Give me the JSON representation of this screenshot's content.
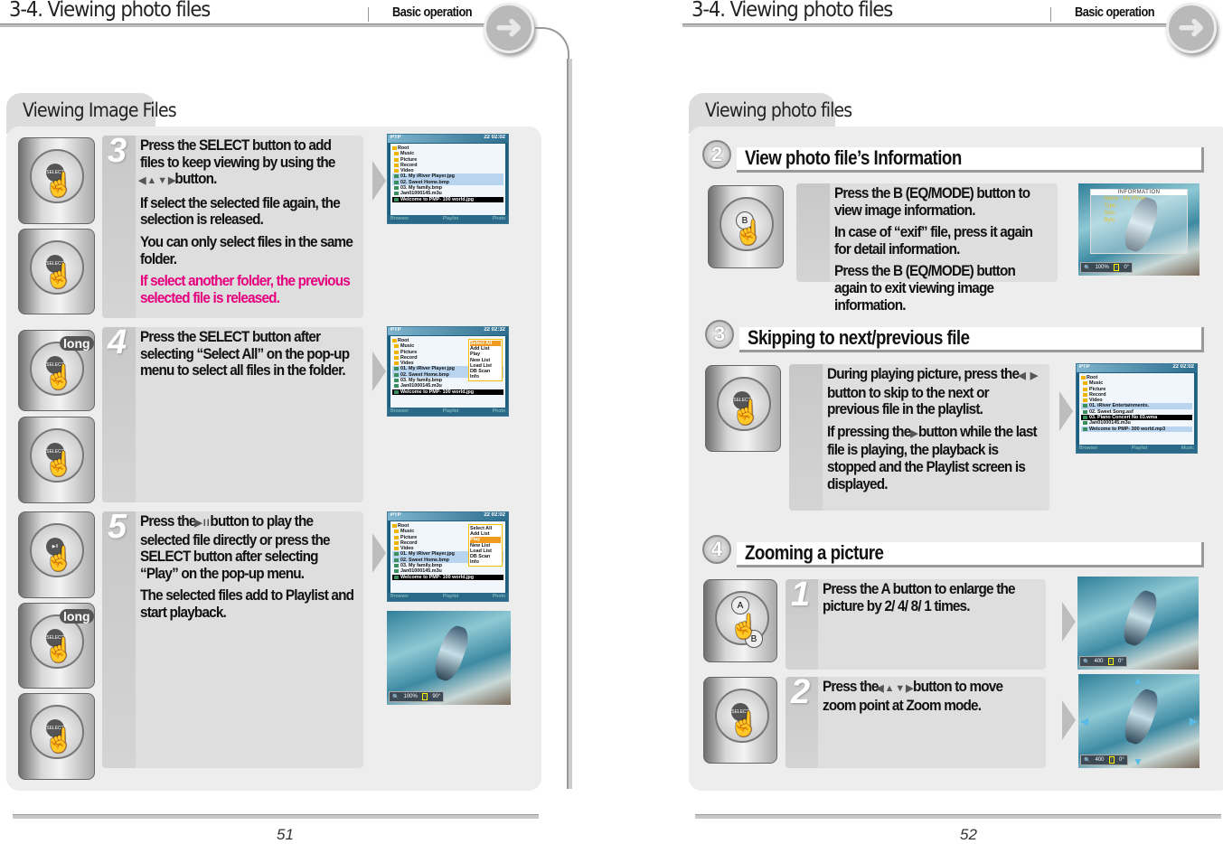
{
  "left": {
    "header": {
      "title": "3-4. Viewing photo files",
      "badge": "Basic operation"
    },
    "section_tab": "Viewing Image Files",
    "steps": [
      {
        "number": "3",
        "paragraphs": [
          {
            "before": "Press the SELECT button to add files to keep viewing by using the",
            "icon": "direction-arrows",
            "after": "button."
          },
          {
            "text": "If select the selected file again, the selection is released."
          },
          {
            "text": "You can only select files in the same folder."
          },
          {
            "text": "If select another folder, the previous selected file is released.",
            "highlight": true
          }
        ]
      },
      {
        "number": "4",
        "paragraphs": [
          {
            "text": "Press the SELECT button after selecting “Select All” on the pop-up menu to select all files in the folder."
          }
        ]
      },
      {
        "number": "5",
        "paragraphs": [
          {
            "before": "Press the",
            "icon": "play-pause",
            "after": "button to play the selected file directly or press the SELECT button after selecting “Play” on the pop-up menu."
          },
          {
            "text": "The selected files add to Playlist and start playback."
          }
        ]
      }
    ],
    "devices": [
      {
        "label": "SELECT"
      },
      {
        "label": "SELECT"
      },
      {
        "label": "SELECT",
        "badge": "long"
      },
      {
        "label": "SELECT"
      },
      {
        "label": "▶II"
      },
      {
        "label": "SELECT",
        "badge": "long"
      },
      {
        "label": "SELECT"
      }
    ],
    "page_number": "51"
  },
  "right": {
    "header": {
      "title": "3-4. Viewing photo files",
      "badge": "Basic operation"
    },
    "section_tab": "Viewing photo files",
    "subsections": [
      {
        "number": "2",
        "title": "View photo file’s Information",
        "paragraphs": [
          {
            "text": "Press the B (EQ/MODE) button to view image information."
          },
          {
            "text": "In case of “exif” file, press it again for detail information."
          },
          {
            "text": "Press the B (EQ/MODE) button again to exit viewing image information."
          }
        ]
      },
      {
        "number": "3",
        "title": "Skipping to next/previous file",
        "paragraphs": [
          {
            "before": "During playing picture, press the",
            "icon": "left-right-arrows",
            "after": "button to skip to the next or previous file in the playlist."
          },
          {
            "before": "If pressing the",
            "icon": "right-arrow",
            "after": "button while the last file is playing, the playback is stopped and the Playlist screen is displayed."
          }
        ]
      },
      {
        "number": "4",
        "title": "Zooming a picture",
        "steps": [
          {
            "number": "1",
            "paragraphs": [
              {
                "text": "Press the A button to enlarge the picture by 2/ 4/ 8/ 1 times."
              }
            ]
          },
          {
            "number": "2",
            "paragraphs": [
              {
                "before": "Press the",
                "icon": "direction-arrows",
                "after": "button to move zoom point at Zoom mode."
              }
            ]
          }
        ]
      }
    ],
    "devices": [
      {
        "label": "B"
      },
      {
        "label": "SELECT"
      },
      {
        "label": "A",
        "label2": "B"
      },
      {
        "label": "SELECT"
      }
    ],
    "page_number": "52"
  },
  "screens": {
    "s3": {
      "brand": "PTP",
      "status": "22  02:02",
      "items": [
        {
          "t": "Root",
          "k": "root"
        },
        {
          "t": "Music"
        },
        {
          "t": "Picture"
        },
        {
          "t": "Record"
        },
        {
          "t": "Video"
        },
        {
          "t": "01. My iRiver Player.jpg",
          "k": "file sel"
        },
        {
          "t": "02. Sweet Home.bmp",
          "k": "file sel"
        },
        {
          "t": "03. My family.bmp",
          "k": "file"
        },
        {
          "t": "Jan01000145.m3u",
          "k": "file"
        },
        {
          "t": "Welcome to PMP- 100 world.jpg",
          "k": "file cur"
        }
      ],
      "footer": [
        "Browser",
        "Playlist",
        "Photo"
      ]
    },
    "s4": {
      "brand": "PTP",
      "status": "22  02:32",
      "items": [
        {
          "t": "Root",
          "k": "root"
        },
        {
          "t": "Music"
        },
        {
          "t": "Picture"
        },
        {
          "t": "Record"
        },
        {
          "t": "Video"
        },
        {
          "t": "01. My iRiver Player.jpg",
          "k": "file sel"
        },
        {
          "t": "02. Sweet Home.bmp",
          "k": "file sel"
        },
        {
          "t": "03. My family.bmp",
          "k": "file"
        },
        {
          "t": "Jan01000145.m3u",
          "k": "file"
        },
        {
          "t": "Welcome to PMP- 100 world.jpg",
          "k": "file cur"
        }
      ],
      "popup": [
        "Select All",
        "Add List",
        "Play",
        "New List",
        "Load List",
        "DB Scan",
        "Info"
      ],
      "popup_active": 0,
      "footer": [
        "Browser",
        "Playlist",
        "Photo"
      ]
    },
    "s5": {
      "brand": "PTP",
      "status": "22  02:02",
      "items": [
        {
          "t": "Root",
          "k": "root"
        },
        {
          "t": "Music"
        },
        {
          "t": "Picture"
        },
        {
          "t": "Record"
        },
        {
          "t": "Video"
        },
        {
          "t": "01. My iRiver Player.jpg",
          "k": "file sel"
        },
        {
          "t": "02. Sweet Home.bmp",
          "k": "file sel"
        },
        {
          "t": "03. My family.bmp",
          "k": "file"
        },
        {
          "t": "Jan01000145.m3u",
          "k": "file"
        },
        {
          "t": "Welcome to PMP- 100 world.jpg",
          "k": "file cur"
        }
      ],
      "popup": [
        "Select All",
        "Add List",
        "Play",
        "New List",
        "Load List",
        "DB Scan",
        "Info"
      ],
      "popup_active": 2,
      "footer": [
        "Browser",
        "Playlist",
        "Photo"
      ]
    },
    "skip": {
      "brand": "PTP",
      "status": "22  02:02",
      "items": [
        {
          "t": "Root",
          "k": "root"
        },
        {
          "t": "Music"
        },
        {
          "t": "Picture"
        },
        {
          "t": "Record"
        },
        {
          "t": "Video"
        },
        {
          "t": "01. iRiver Entertainments.",
          "k": "file sel"
        },
        {
          "t": "02. Sweet Song.asf",
          "k": "file"
        },
        {
          "t": "03. Piano Concert No 03.wma",
          "k": "file cur"
        },
        {
          "t": "Jan01000145.m3u",
          "k": "file"
        },
        {
          "t": "Welcome to PMP- 300 world.mp3",
          "k": "file sel"
        }
      ],
      "footer": [
        "Browser",
        "Playlist",
        "Music"
      ]
    }
  },
  "photos": {
    "p5": {
      "zoom": "100%",
      "angle": "90°"
    },
    "info": {
      "zoom": "100%",
      "angle": "0°",
      "info_title": "INFORMATION",
      "rows": [
        "Name : My iRiver",
        "Type :",
        "Size :",
        "Byte :"
      ]
    },
    "z1": {
      "zoom": "400",
      "angle": "0°"
    },
    "z2": {
      "zoom": "400",
      "angle": "0°",
      "chevrons": true
    }
  }
}
